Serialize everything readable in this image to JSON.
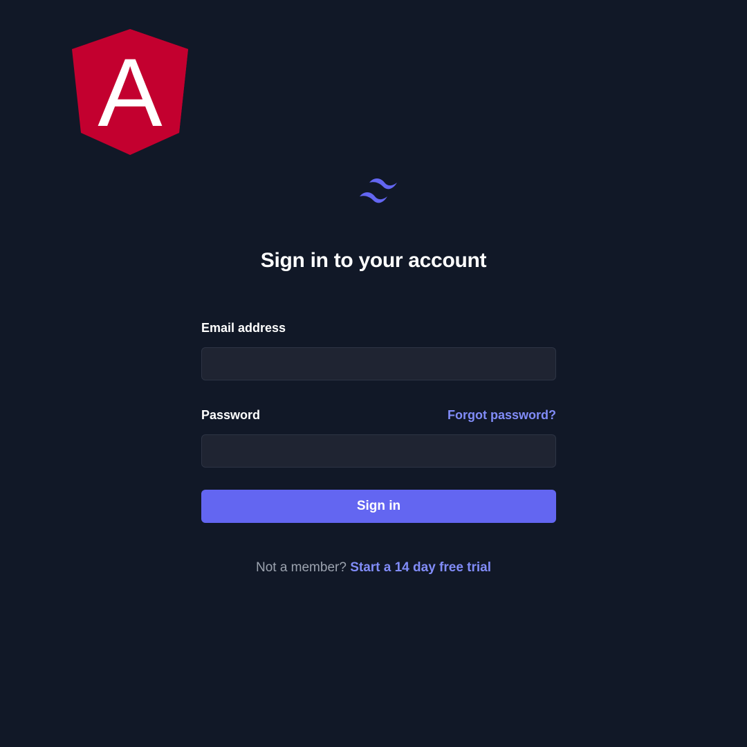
{
  "branding": {
    "angular_logo_letter": "A",
    "angular_logo_icon": "angular-shield-logo",
    "tailwind_logo_icon": "tailwind-wave-logo",
    "angular_red": "#c3002f",
    "accent": "#6366f1",
    "accent_link": "#818cf8",
    "background": "#111827"
  },
  "heading": {
    "title": "Sign in to your account"
  },
  "form": {
    "email_label": "Email address",
    "email_value": "",
    "password_label": "Password",
    "password_value": "",
    "forgot_password_link": "Forgot password?",
    "submit_label": "Sign in"
  },
  "footer": {
    "prompt": "Not a member?",
    "trial_link": "Start a 14 day free trial"
  }
}
